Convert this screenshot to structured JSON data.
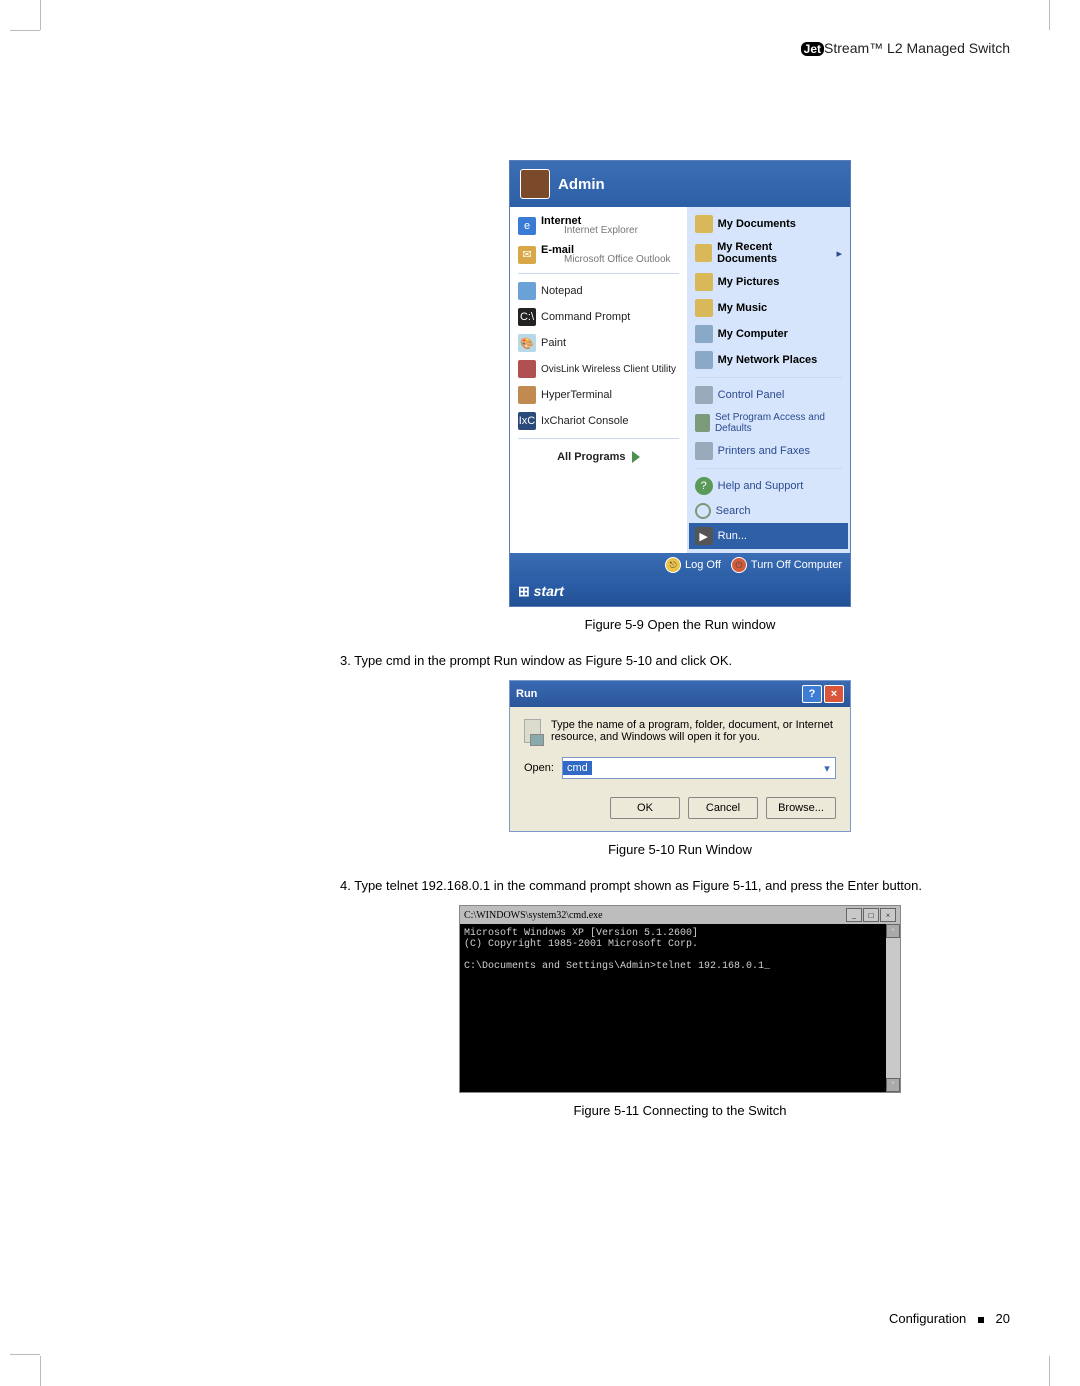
{
  "header": {
    "brand_pre": "Jet",
    "brand_post": "Stream™",
    "product": "L2 Managed Switch"
  },
  "startmenu": {
    "user": "Admin",
    "left": {
      "internet_title": "Internet",
      "internet_sub": "Internet Explorer",
      "email_title": "E-mail",
      "email_sub": "Microsoft Office Outlook",
      "notepad": "Notepad",
      "cmd": "Command Prompt",
      "paint": "Paint",
      "ovislink": "OvisLink Wireless Client Utility",
      "hyper": "HyperTerminal",
      "ixchariot": "IxChariot Console",
      "all_programs": "All Programs"
    },
    "right": {
      "mydocs": "My Documents",
      "recent": "My Recent Documents",
      "pictures": "My Pictures",
      "music": "My Music",
      "computer": "My Computer",
      "netplaces": "My Network Places",
      "cpanel": "Control Panel",
      "spa": "Set Program Access and Defaults",
      "printers": "Printers and Faxes",
      "help": "Help and Support",
      "search": "Search",
      "run": "Run..."
    },
    "footer": {
      "logoff": "Log Off",
      "turnoff": "Turn Off Computer"
    },
    "taskbar": "start"
  },
  "captions": {
    "fig59": "Figure 5-9  Open the Run window",
    "fig510": "Figure 5-10  Run Window",
    "fig511": "Figure 5-11  Connecting to the Switch"
  },
  "steps": {
    "s3": "3. Type cmd in the prompt Run window as Figure 5-10 and click OK.",
    "s4": "4. Type telnet 192.168.0.1 in the command prompt shown as Figure 5-11, and press the Enter button."
  },
  "run_dialog": {
    "title": "Run",
    "desc": "Type the name of a program, folder, document, or Internet resource, and Windows will open it for you.",
    "open_label": "Open:",
    "value": "cmd",
    "ok": "OK",
    "cancel": "Cancel",
    "browse": "Browse..."
  },
  "cmd_window": {
    "title": "C:\\WINDOWS\\system32\\cmd.exe",
    "line1": "Microsoft Windows XP [Version 5.1.2600]",
    "line2": "(C) Copyright 1985-2001 Microsoft Corp.",
    "line3": "C:\\Documents and Settings\\Admin>telnet 192.168.0.1_"
  },
  "footer": {
    "section": "Configuration",
    "page": "20"
  }
}
